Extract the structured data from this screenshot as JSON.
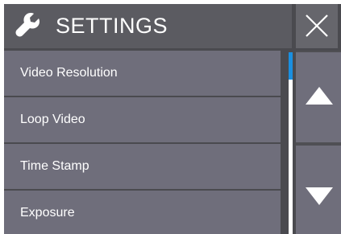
{
  "header": {
    "title": "SETTINGS",
    "icon": "wrench-icon",
    "close_icon": "close-icon"
  },
  "menu": {
    "items": [
      {
        "label": "Video Resolution"
      },
      {
        "label": "Loop Video"
      },
      {
        "label": "Time Stamp"
      },
      {
        "label": "Exposure"
      }
    ]
  },
  "navigation": {
    "up_icon": "arrow-up-icon",
    "down_icon": "arrow-down-icon"
  },
  "colors": {
    "header_bg": "#5b5b61",
    "item_bg": "#6f6e7b",
    "background": "#4a4a4f",
    "scroll_thumb": "#1a8fe0",
    "text": "#ffffff"
  }
}
